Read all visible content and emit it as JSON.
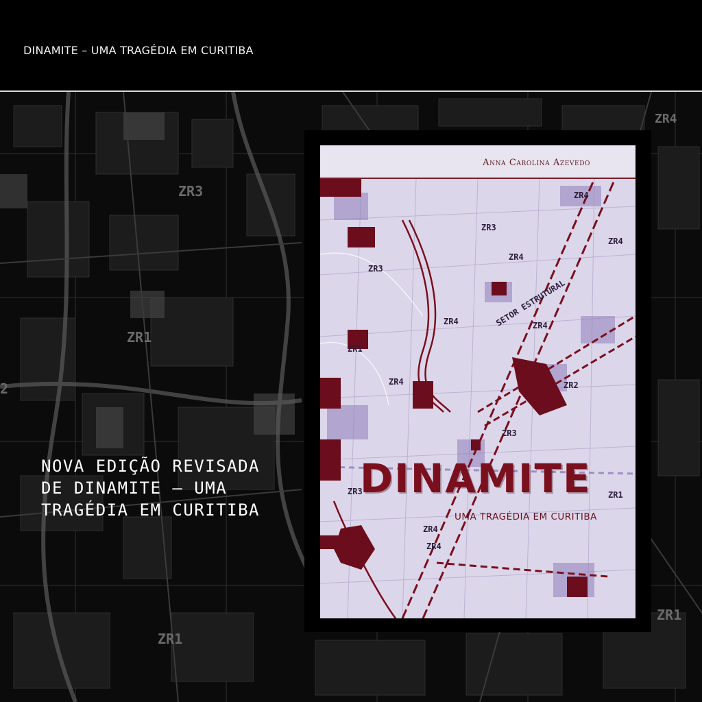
{
  "header": {
    "title": "DINAMITE – UMA TRAGÉDIA EM CURITIBA"
  },
  "headline": {
    "lines": [
      "NOVA EDIÇÃO REVISADA",
      "DE DINAMITE – UMA",
      "TRAGÉDIA EM CURITIBA"
    ]
  },
  "book": {
    "author": "Anna Carolina Azevedo",
    "title": "DINAMITE",
    "subtitle": "UMA TRAGÉDIA EM CURITIBA",
    "map_labels": [
      "ZR4",
      "ZR3",
      "ZR3",
      "ZR4",
      "ZR4",
      "ZR4",
      "ZR1",
      "ZR4",
      "SETOR ESTRUTURAL",
      "ZR4",
      "ZR2",
      "ZR3",
      "ZR1",
      "ZR4",
      "ZR4",
      "ZR3"
    ]
  },
  "background": {
    "map_labels": [
      "ZR3",
      "ZR1",
      "ZR1",
      "ZR4",
      "ZR1",
      "2"
    ]
  },
  "colors": {
    "accent": "#7a0f1e",
    "cover_bg": "#ddd8ea",
    "page_bg": "#000000"
  }
}
